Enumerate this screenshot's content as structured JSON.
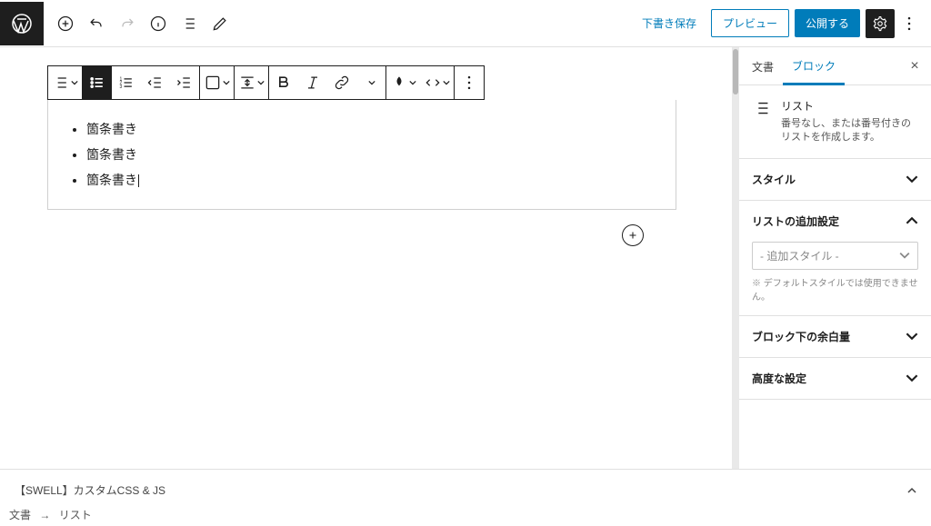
{
  "top": {
    "save_draft": "下書き保存",
    "preview": "プレビュー",
    "publish": "公開する"
  },
  "list": {
    "item1": "箇条書き",
    "item2": "箇条書き",
    "item3": "箇条書き"
  },
  "sidebar": {
    "tab_document": "文書",
    "tab_block": "ブロック",
    "block": {
      "title": "リスト",
      "desc": "番号なし、または番号付きのリストを作成します。"
    },
    "panels": {
      "style": "スタイル",
      "list_extra": "リストの追加設定",
      "extra_select_placeholder": "- 追加スタイル -",
      "extra_note": "※ デフォルトスタイルでは使用できません。",
      "margin": "ブロック下の余白量",
      "advanced": "高度な設定"
    }
  },
  "bottom": {
    "swell": "【SWELL】カスタムCSS & JS"
  },
  "breadcrumb": {
    "doc": "文書",
    "sep": "→",
    "block": "リスト"
  }
}
